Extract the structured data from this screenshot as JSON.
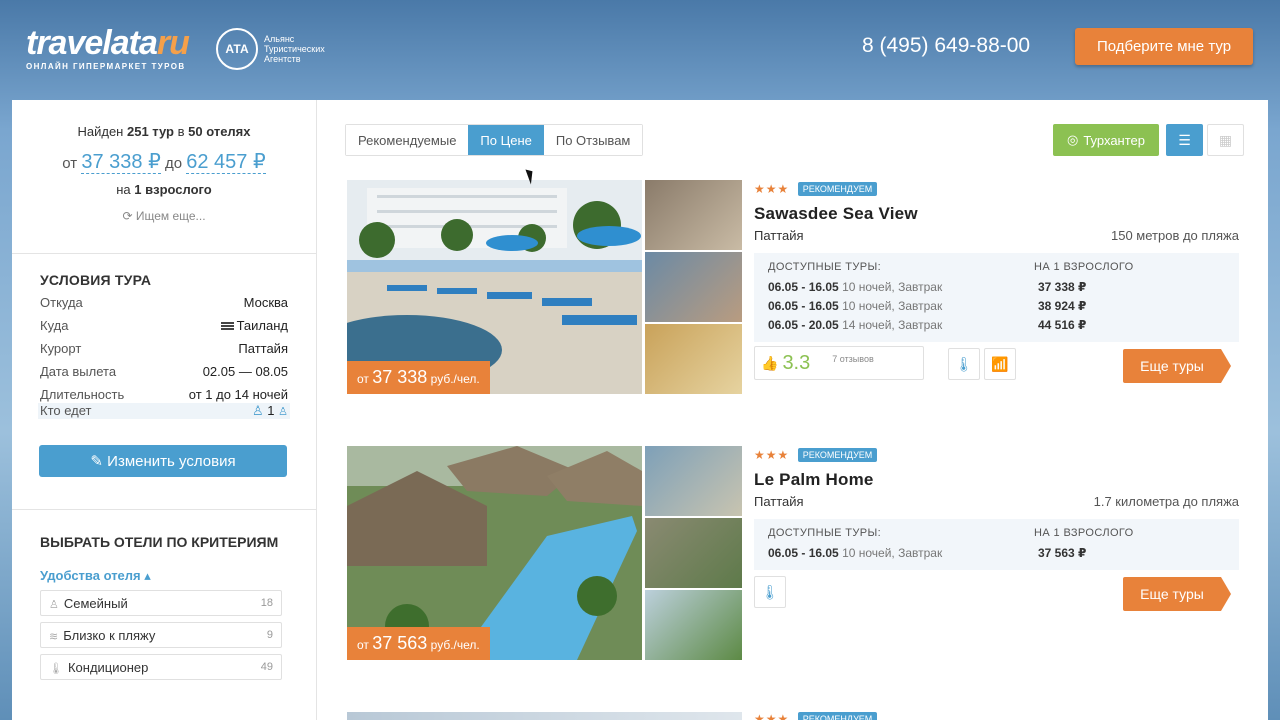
{
  "header": {
    "logo_main": "travelata",
    "logo_ru": "ru",
    "logo_sub": "ОНЛАЙН ГИПЕРМАРКЕТ ТУРОВ",
    "ata_badge": "АТА",
    "ata_text": "Альянс Туристических Агентств",
    "phone": "8 (495) 649-88-00",
    "pick_button": "Подберите мне тур"
  },
  "sidebar": {
    "found_prefix": "Найден",
    "found_count": "251 тур",
    "found_mid": "в",
    "found_hotels": "50 отелях",
    "price_from_label": "от",
    "price_from": "37 338 ₽",
    "price_to_label": "до",
    "price_to": "62 457 ₽",
    "adult_prefix": "на",
    "adult_value": "1 взрослого",
    "searching": "Ищем еще...",
    "conditions_title": "УСЛОВИЯ ТУРА",
    "conditions": [
      {
        "key": "Откуда",
        "value": "Москва"
      },
      {
        "key": "Куда",
        "value": "Таиланд"
      },
      {
        "key": "Курорт",
        "value": "Паттайя"
      },
      {
        "key": "Дата вылета",
        "value": "02.05 — 08.05"
      },
      {
        "key": "Длительность",
        "value": "от 1 до 14 ночей"
      },
      {
        "key": "Кто едет",
        "value": "1"
      }
    ],
    "change_button": "Изменить условия",
    "criteria_title": "ВЫБРАТЬ ОТЕЛИ ПО КРИТЕРИЯМ",
    "amenities_link": "Удобства отеля",
    "amenities": [
      {
        "label": "Семейный",
        "count": "18"
      },
      {
        "label": "Близко к пляжу",
        "count": "9"
      },
      {
        "label": "Кондиционер",
        "count": "49"
      }
    ]
  },
  "main": {
    "sort_tabs": [
      "Рекомендуемые",
      "По Цене",
      "По Отзывам"
    ],
    "active_sort": "По Цене",
    "turhunter": "Турхантер",
    "hotels": [
      {
        "badge": "РЕКОМЕНДУЕМ",
        "stars": 3,
        "name": "Sawasdee Sea View",
        "city": "Паттайя",
        "distance": "150 метров до пляжа",
        "tours_header": "ДОСТУПНЫЕ ТУРЫ:",
        "price_header": "НА 1 ВЗРОСЛОГО",
        "tours": [
          {
            "dates": "06.05 - 16.05",
            "details": "10 ночей, Завтрак",
            "price": "37 338 ₽"
          },
          {
            "dates": "06.05 - 16.05",
            "details": "10 ночей, Завтрак",
            "price": "38 924 ₽"
          },
          {
            "dates": "06.05 - 20.05",
            "details": "14 ночей, Завтрак",
            "price": "44 516 ₽"
          }
        ],
        "price_tag_prefix": "от",
        "price_tag_value": "37 338",
        "price_tag_unit": "руб./чел.",
        "rating": "3.3",
        "reviews": "7 отзывов",
        "more_button": "Еще туры"
      },
      {
        "badge": "РЕКОМЕНДУЕМ",
        "stars": 3,
        "name": "Le Palm Home",
        "city": "Паттайя",
        "distance": "1.7 километра до пляжа",
        "tours_header": "ДОСТУПНЫЕ ТУРЫ:",
        "price_header": "НА 1 ВЗРОСЛОГО",
        "tours": [
          {
            "dates": "06.05 - 16.05",
            "details": "10 ночей, Завтрак",
            "price": "37 563 ₽"
          }
        ],
        "price_tag_prefix": "от",
        "price_tag_value": "37 563",
        "price_tag_unit": "руб./чел.",
        "more_button": "Еще туры"
      }
    ],
    "third_badge": "РЕКОМЕНДУЕМ"
  },
  "colors": {
    "accent_orange": "#e8823a",
    "accent_blue": "#4a9ecf",
    "accent_green": "#8cc152"
  }
}
